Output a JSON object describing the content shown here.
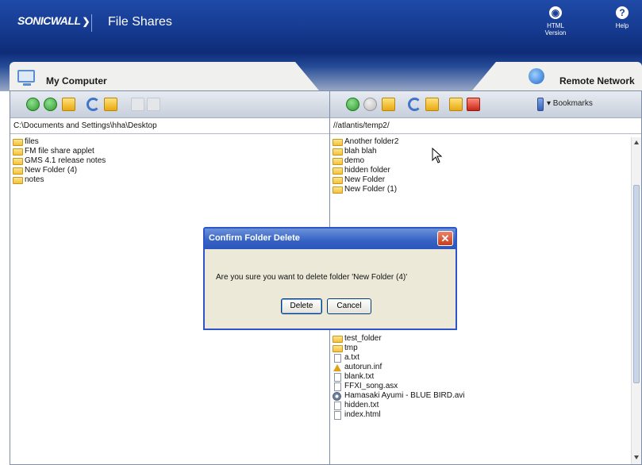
{
  "header": {
    "logo": "SONICWALL",
    "title": "File Shares",
    "html_version_label": "HTML Version",
    "help_label": "Help"
  },
  "tabs": {
    "left_label": "My Computer",
    "right_label": "Remote Network"
  },
  "left_panel": {
    "path": "C:\\Documents and Settings\\hha\\Desktop",
    "items": [
      {
        "name": "files",
        "icon": "folder"
      },
      {
        "name": "FM file share applet",
        "icon": "folder"
      },
      {
        "name": "GMS 4.1 release notes",
        "icon": "folder"
      },
      {
        "name": "New Folder (4)",
        "icon": "folder"
      },
      {
        "name": "notes",
        "icon": "folder"
      }
    ]
  },
  "right_panel": {
    "bookmarks_label": "▾ Bookmarks",
    "path": "//atlantis/temp2/",
    "items_top": [
      {
        "name": "Another folder2",
        "icon": "folder"
      },
      {
        "name": "blah blah",
        "icon": "folder"
      },
      {
        "name": "demo",
        "icon": "folder"
      },
      {
        "name": "hidden folder",
        "icon": "folder"
      },
      {
        "name": "New Folder",
        "icon": "folder"
      },
      {
        "name": "New Folder (1)",
        "icon": "folder"
      }
    ],
    "items_bottom": [
      {
        "name": "test_folder",
        "icon": "folder"
      },
      {
        "name": "tmp",
        "icon": "folder"
      },
      {
        "name": "a.txt",
        "icon": "file"
      },
      {
        "name": "autorun.inf",
        "icon": "arrow"
      },
      {
        "name": "blank.txt",
        "icon": "file"
      },
      {
        "name": "FFXI_song.asx",
        "icon": "file"
      },
      {
        "name": "Hamasaki Ayumi - BLUE BIRD.avi",
        "icon": "media"
      },
      {
        "name": "hidden.txt",
        "icon": "file"
      },
      {
        "name": "index.html",
        "icon": "file"
      }
    ]
  },
  "dialog": {
    "title": "Confirm Folder Delete",
    "close": "✕",
    "message": "Are you sure you want to delete folder 'New Folder (4)'",
    "delete_label": "Delete",
    "cancel_label": "Cancel"
  }
}
